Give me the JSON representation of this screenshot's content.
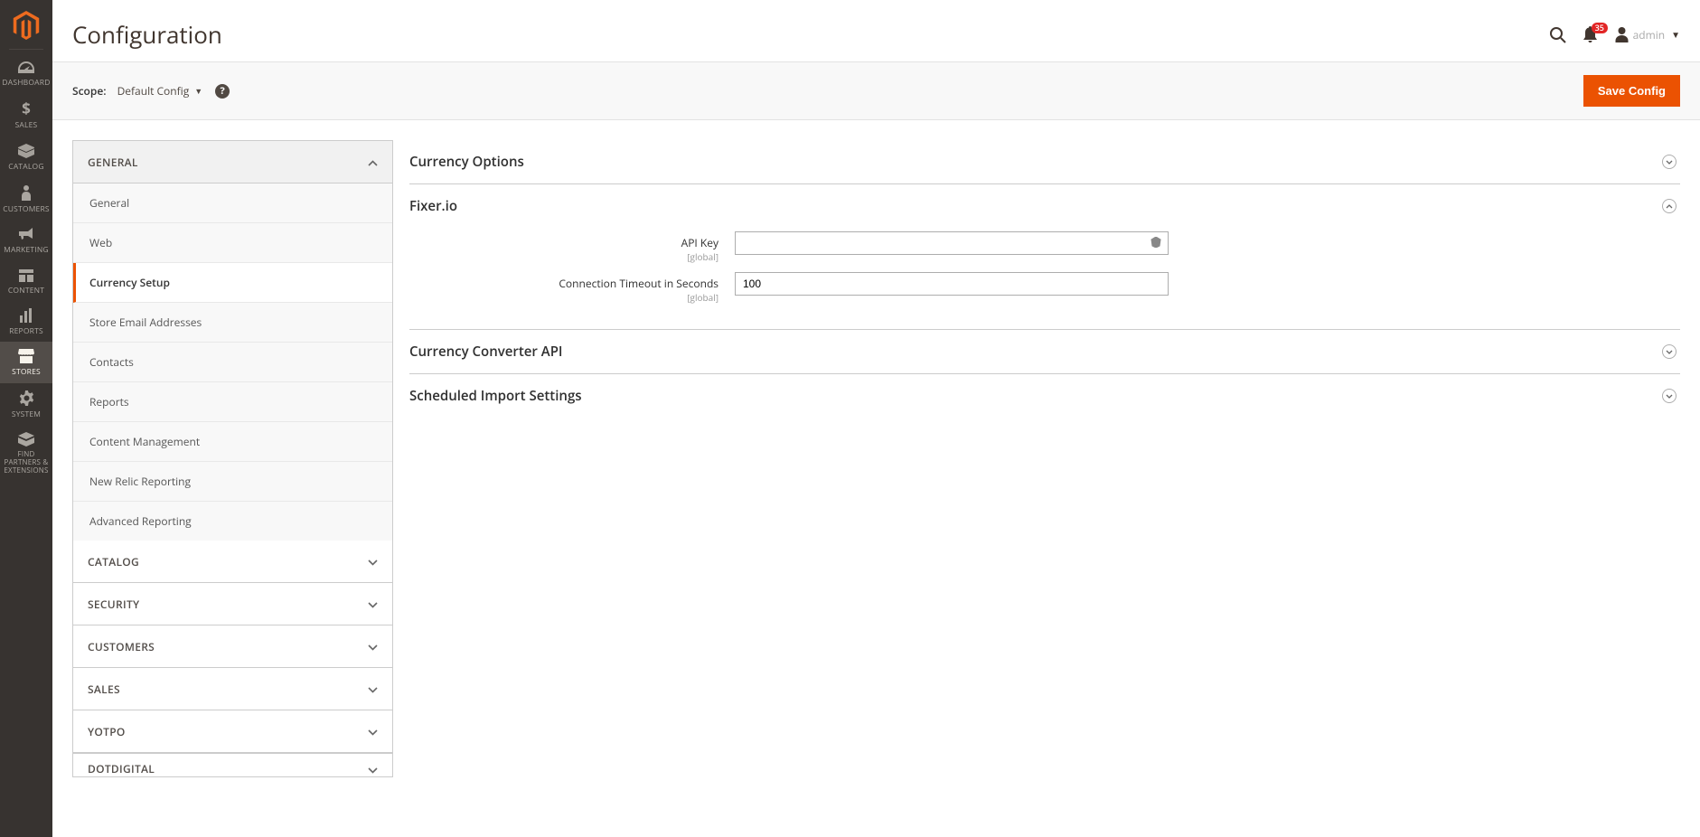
{
  "nav": {
    "items": [
      {
        "label": "DASHBOARD",
        "icon": "dashboard"
      },
      {
        "label": "SALES",
        "icon": "dollar"
      },
      {
        "label": "CATALOG",
        "icon": "box"
      },
      {
        "label": "CUSTOMERS",
        "icon": "person"
      },
      {
        "label": "MARKETING",
        "icon": "megaphone"
      },
      {
        "label": "CONTENT",
        "icon": "blocks"
      },
      {
        "label": "REPORTS",
        "icon": "bars"
      },
      {
        "label": "STORES",
        "icon": "store",
        "active": true
      },
      {
        "label": "SYSTEM",
        "icon": "gear"
      },
      {
        "label": "FIND PARTNERS & EXTENSIONS",
        "icon": "partners"
      }
    ]
  },
  "header": {
    "title": "Configuration",
    "notification_count": "35",
    "admin_name": "admin"
  },
  "scope": {
    "label": "Scope:",
    "value": "Default Config",
    "save_button": "Save Config"
  },
  "tabs": [
    {
      "label": "GENERAL",
      "expanded": true,
      "items": [
        {
          "label": "General"
        },
        {
          "label": "Web"
        },
        {
          "label": "Currency Setup",
          "active": true
        },
        {
          "label": "Store Email Addresses"
        },
        {
          "label": "Contacts"
        },
        {
          "label": "Reports"
        },
        {
          "label": "Content Management"
        },
        {
          "label": "New Relic Reporting"
        },
        {
          "label": "Advanced Reporting"
        }
      ]
    },
    {
      "label": "CATALOG",
      "expanded": false
    },
    {
      "label": "SECURITY",
      "expanded": false
    },
    {
      "label": "CUSTOMERS",
      "expanded": false
    },
    {
      "label": "SALES",
      "expanded": false
    },
    {
      "label": "YOTPO",
      "expanded": false
    },
    {
      "label": "DOTDIGITAL",
      "expanded": false
    }
  ],
  "sections": {
    "currency_options": {
      "title": "Currency Options",
      "expanded": false
    },
    "fixer_io": {
      "title": "Fixer.io",
      "expanded": true,
      "fields": {
        "api_key": {
          "label": "API Key",
          "scope": "[global]",
          "value": ""
        },
        "timeout": {
          "label": "Connection Timeout in Seconds",
          "scope": "[global]",
          "value": "100"
        }
      }
    },
    "converter_api": {
      "title": "Currency Converter API",
      "expanded": false
    },
    "scheduled_import": {
      "title": "Scheduled Import Settings",
      "expanded": false
    }
  }
}
